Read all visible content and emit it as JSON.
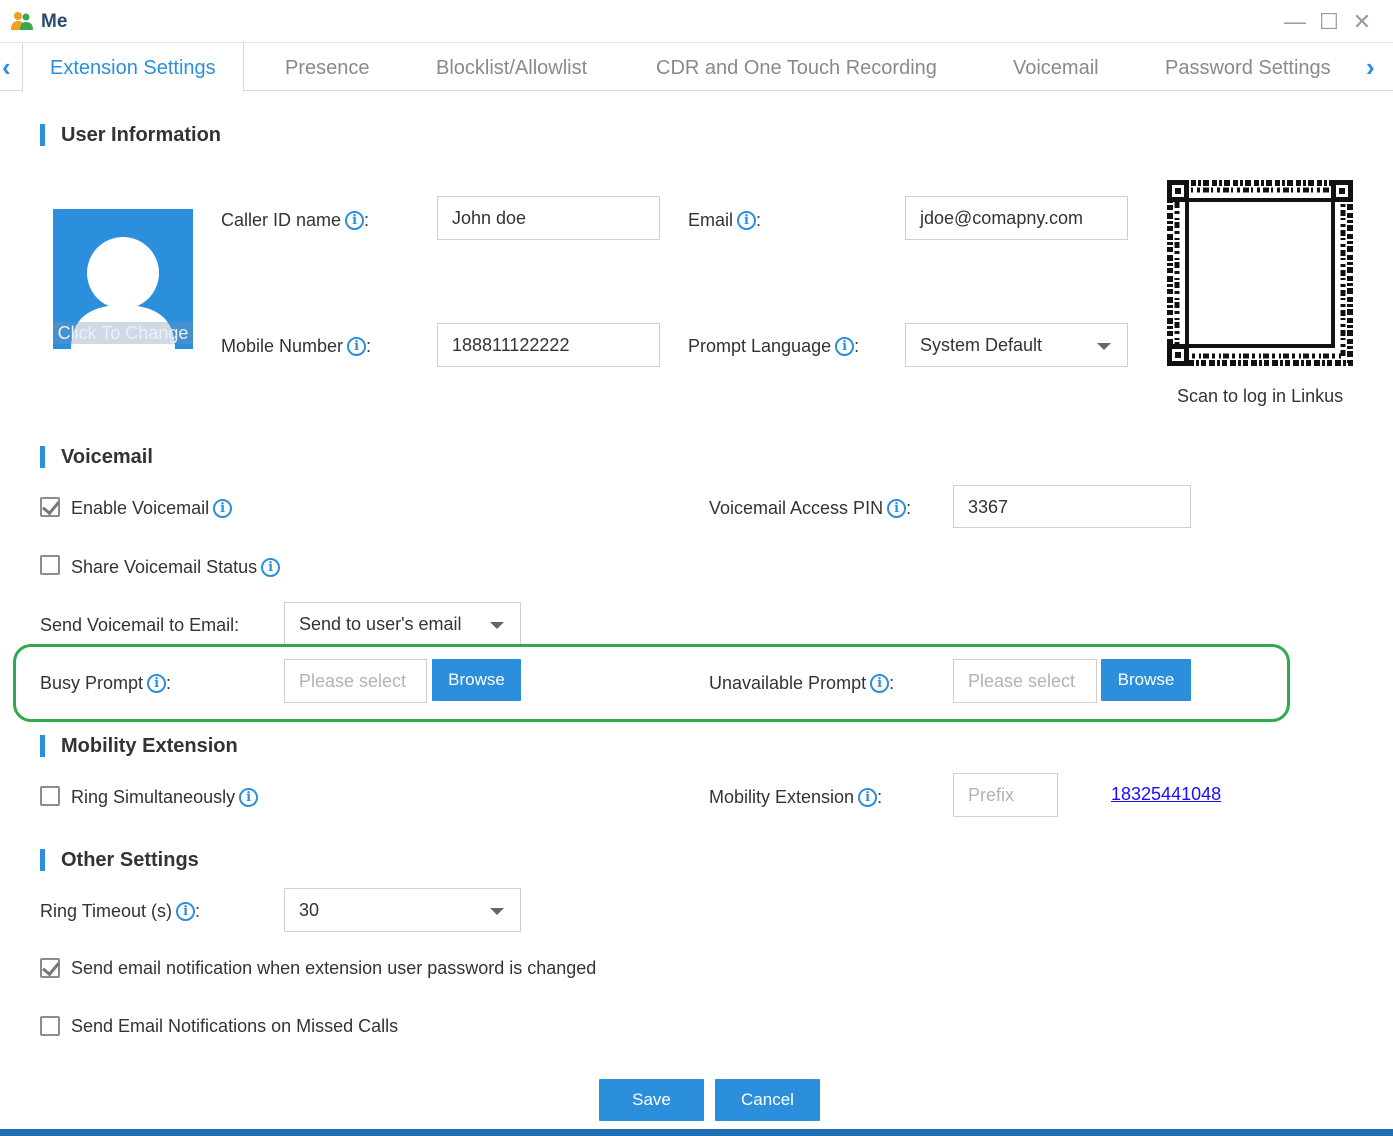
{
  "window": {
    "title": "Me",
    "minimize": "—",
    "maximize": "☐",
    "close": "✕"
  },
  "tabs": [
    {
      "label": "Extension Settings",
      "active": true
    },
    {
      "label": "Presence"
    },
    {
      "label": "Blocklist/Allowlist"
    },
    {
      "label": "CDR and One Touch Recording"
    },
    {
      "label": "Voicemail"
    },
    {
      "label": "Password Settings"
    }
  ],
  "user_info": {
    "title": "User Information",
    "avatar_caption": "Click To Change",
    "caller_id_label": "Caller ID name",
    "caller_id_value": "John doe",
    "email_label": "Email",
    "email_value": "jdoe@comapny.com",
    "mobile_label": "Mobile Number",
    "mobile_value": "188811122222",
    "prompt_lang_label": "Prompt Language",
    "prompt_lang_value": "System Default",
    "qr_caption": "Scan to log in Linkus"
  },
  "voicemail": {
    "title": "Voicemail",
    "enable_label": "Enable Voicemail",
    "enable_checked": true,
    "pin_label": "Voicemail Access PIN",
    "pin_value": "3367",
    "share_label": "Share Voicemail Status",
    "share_checked": false,
    "send_email_label": "Send Voicemail to Email:",
    "send_email_value": "Send to user's email",
    "busy_label": "Busy Prompt",
    "busy_placeholder": "Please select",
    "unavail_label": "Unavailable Prompt",
    "unavail_placeholder": "Please select",
    "browse_label": "Browse"
  },
  "mobility": {
    "title": "Mobility Extension",
    "ring_label": "Ring Simultaneously",
    "ring_checked": false,
    "ext_label": "Mobility Extension",
    "prefix_placeholder": "Prefix",
    "number_link": "18325441048"
  },
  "other": {
    "title": "Other Settings",
    "timeout_label": "Ring Timeout (s)",
    "timeout_value": "30",
    "pwd_notify_label": "Send email notification when extension user password is changed",
    "pwd_notify_checked": true,
    "missed_label": "Send Email Notifications on Missed Calls",
    "missed_checked": false
  },
  "footer": {
    "save": "Save",
    "cancel": "Cancel"
  },
  "colors": {
    "accent": "#2b8fdb",
    "highlight": "#2eaa4a"
  }
}
